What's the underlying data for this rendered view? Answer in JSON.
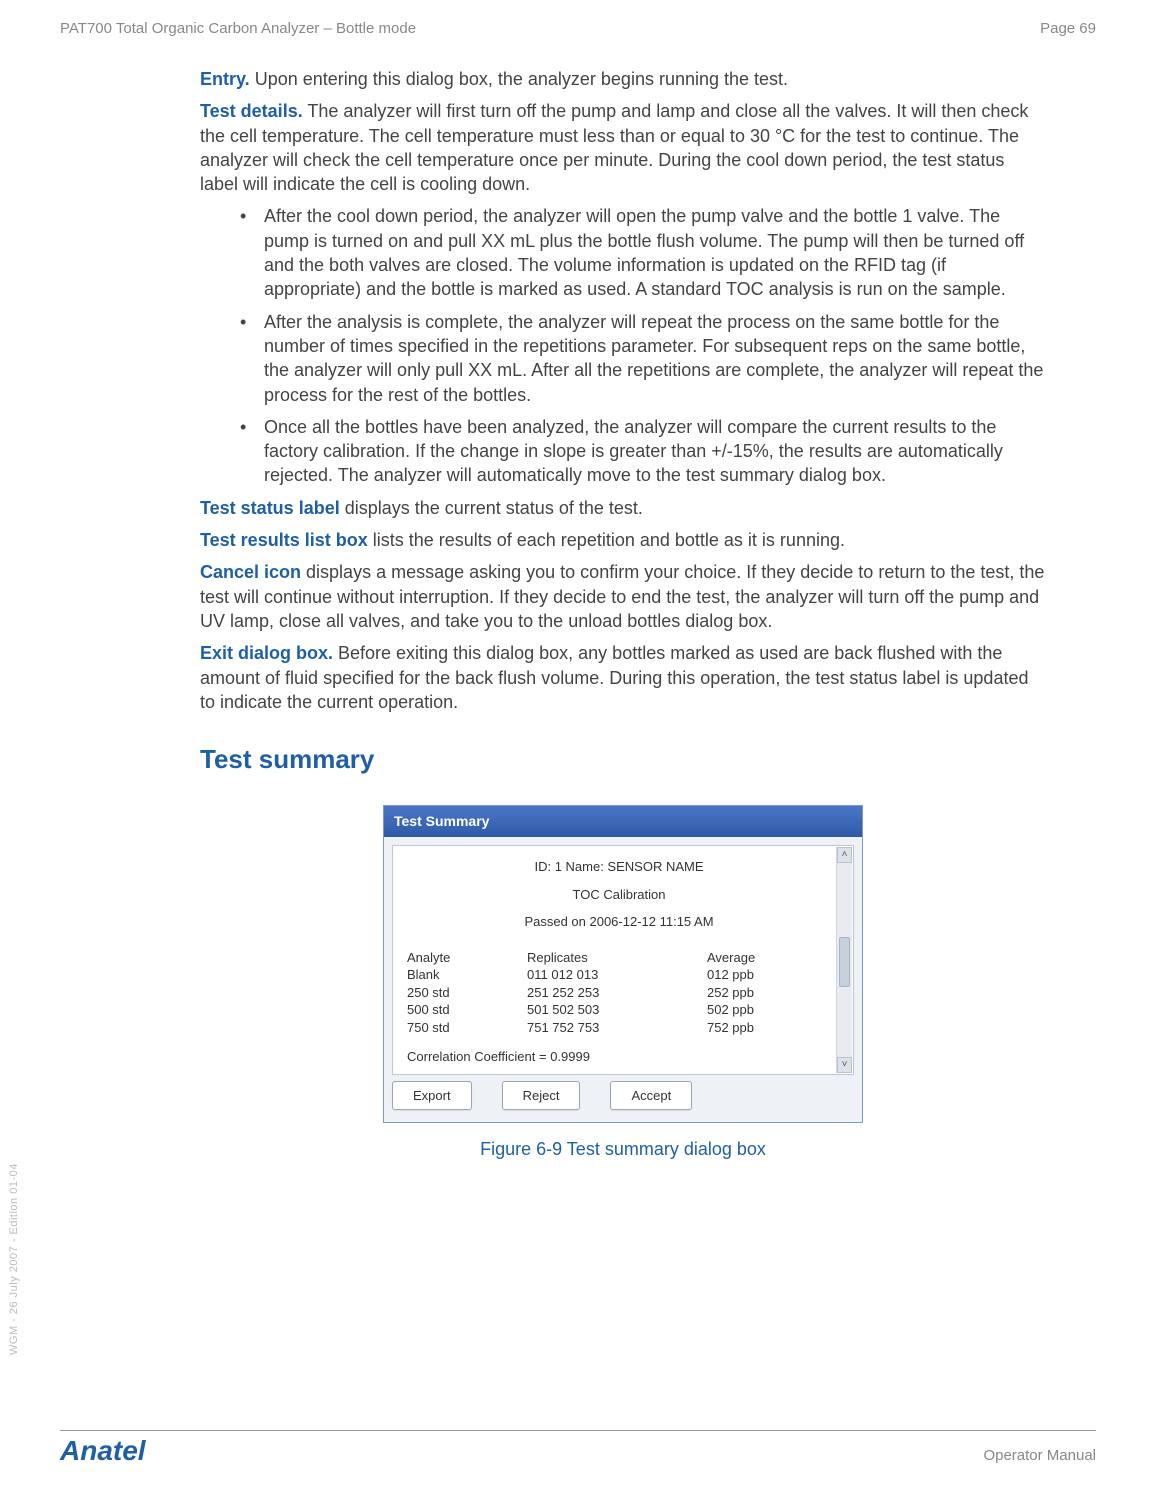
{
  "header": {
    "left": "PAT700 Total Organic Carbon Analyzer – Bottle mode",
    "right": "Page 69"
  },
  "paragraphs": {
    "entry_term": "Entry.",
    "entry_text": " Upon entering this dialog box, the analyzer begins running the test.",
    "details_term": "Test details.",
    "details_text": " The analyzer will first turn off the pump and lamp and close all the valves. It will then check the cell temperature. The cell temperature must less than or equal to 30 °C for the test to continue. The analyzer will check the cell temperature once per minute. During the cool down period, the test status label will indicate the cell is cooling down.",
    "bullets": [
      "After the cool down period, the analyzer will open the pump valve and the bottle 1 valve. The pump is turned on and pull XX mL plus the bottle flush volume. The pump will then be turned off and the both valves are closed. The volume information is updated on the RFID tag (if appropriate) and the bottle is marked as used. A standard TOC analysis is run on the sample.",
      "After the analysis is complete, the analyzer will repeat the process on the same bottle for the number of times specified in the repetitions parameter. For subsequent reps on the same bottle, the analyzer will only pull XX mL. After all the repetitions are complete, the analyzer will repeat the process for the rest of the bottles.",
      "Once all the bottles have been analyzed, the analyzer will compare the current results to the factory calibration. If the change in slope is greater than +/-15%, the results are automatically rejected. The analyzer will automatically move to the test summary dialog box."
    ],
    "status_term": "Test status label",
    "status_text": " displays the current status of the test.",
    "results_term": "Test results list box",
    "results_text": " lists the results of each repetition and bottle as it is running.",
    "cancel_term": "Cancel icon",
    "cancel_text": " displays a message asking you to confirm your choice. If they decide to return to the test, the test will continue without interruption. If they decide to end the test, the analyzer will turn off the pump and UV lamp, close all valves, and take you to the unload bottles dialog box.",
    "exit_term": "Exit dialog box.",
    "exit_text": " Before exiting this dialog box, any bottles marked as used are back flushed with the amount of fluid specified for the back flush volume. During this operation, the test status label is updated to indicate the current operation."
  },
  "section_heading": "Test summary",
  "dialog": {
    "title": "Test Summary",
    "id_line": "ID: 1  Name: SENSOR NAME",
    "sub1": "TOC Calibration",
    "sub2": "Passed on 2006-12-12 11:15 AM",
    "headers": {
      "c1": "Analyte",
      "c2": "Replicates",
      "c3": "Average"
    },
    "rows": [
      {
        "c1": "Blank",
        "c2": "011 012 013",
        "c3": "012 ppb"
      },
      {
        "c1": "250 std",
        "c2": "251 252 253",
        "c3": "252 ppb"
      },
      {
        "c1": "500 std",
        "c2": "501 502 503",
        "c3": "502 ppb"
      },
      {
        "c1": "750 std",
        "c2": "751 752 753",
        "c3": "752 ppb"
      }
    ],
    "corr": "Correlation Coefficient = 0.9999",
    "buttons": {
      "export": "Export",
      "reject": "Reject",
      "accept": "Accept"
    }
  },
  "figure_caption": "Figure 6-9 Test summary dialog box",
  "side_text": "WGM - 26 July 2007 - Edition 01-04",
  "footer": {
    "brand": "Anatel",
    "right": "Operator Manual"
  }
}
